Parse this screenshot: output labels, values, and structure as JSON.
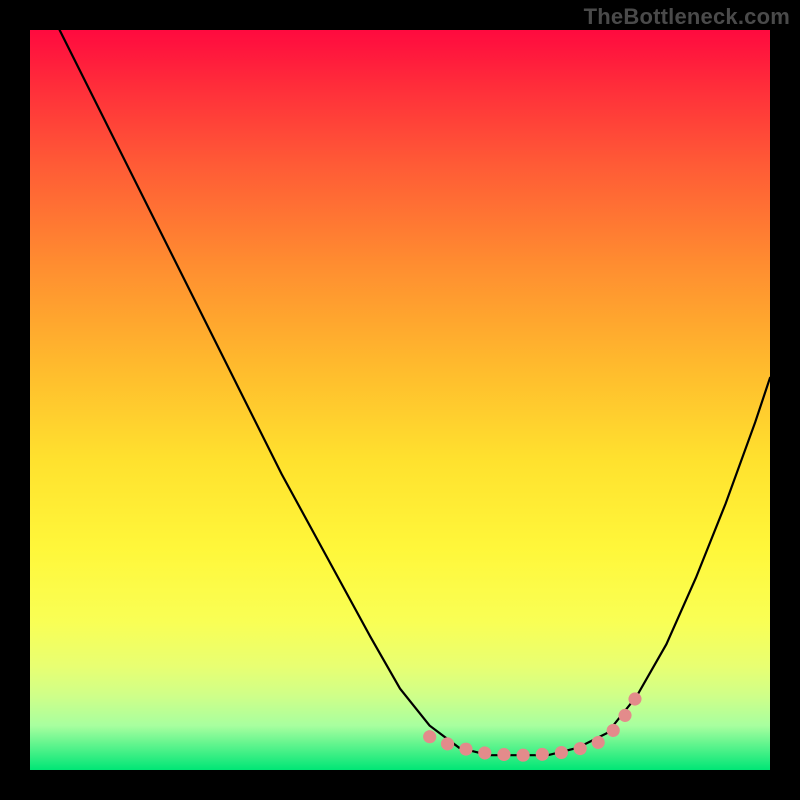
{
  "watermark": "TheBottleneck.com",
  "chart_data": {
    "type": "line",
    "title": "",
    "xlabel": "",
    "ylabel": "",
    "xlim": [
      0,
      100
    ],
    "ylim": [
      0,
      100
    ],
    "background": "rainbow-gradient-red-to-green",
    "series": [
      {
        "name": "bottleneck-curve",
        "x": [
          4,
          10,
          16,
          22,
          28,
          34,
          40,
          46,
          50,
          54,
          58,
          62,
          66,
          70,
          74,
          78,
          82,
          86,
          90,
          94,
          98,
          100
        ],
        "y": [
          100,
          88,
          76,
          64,
          52,
          40,
          29,
          18,
          11,
          6,
          3,
          2,
          2,
          2,
          3,
          5,
          10,
          17,
          26,
          36,
          47,
          53
        ]
      }
    ],
    "highlight": {
      "name": "optimal-range-dots",
      "x": [
        54,
        56.5,
        59,
        61.5,
        64,
        66.5,
        69,
        71.5,
        74,
        76.5,
        79,
        80.5,
        82
      ],
      "y": [
        4.5,
        3.5,
        2.8,
        2.3,
        2.1,
        2.0,
        2.1,
        2.3,
        2.8,
        3.5,
        5.5,
        7.5,
        10
      ]
    }
  }
}
